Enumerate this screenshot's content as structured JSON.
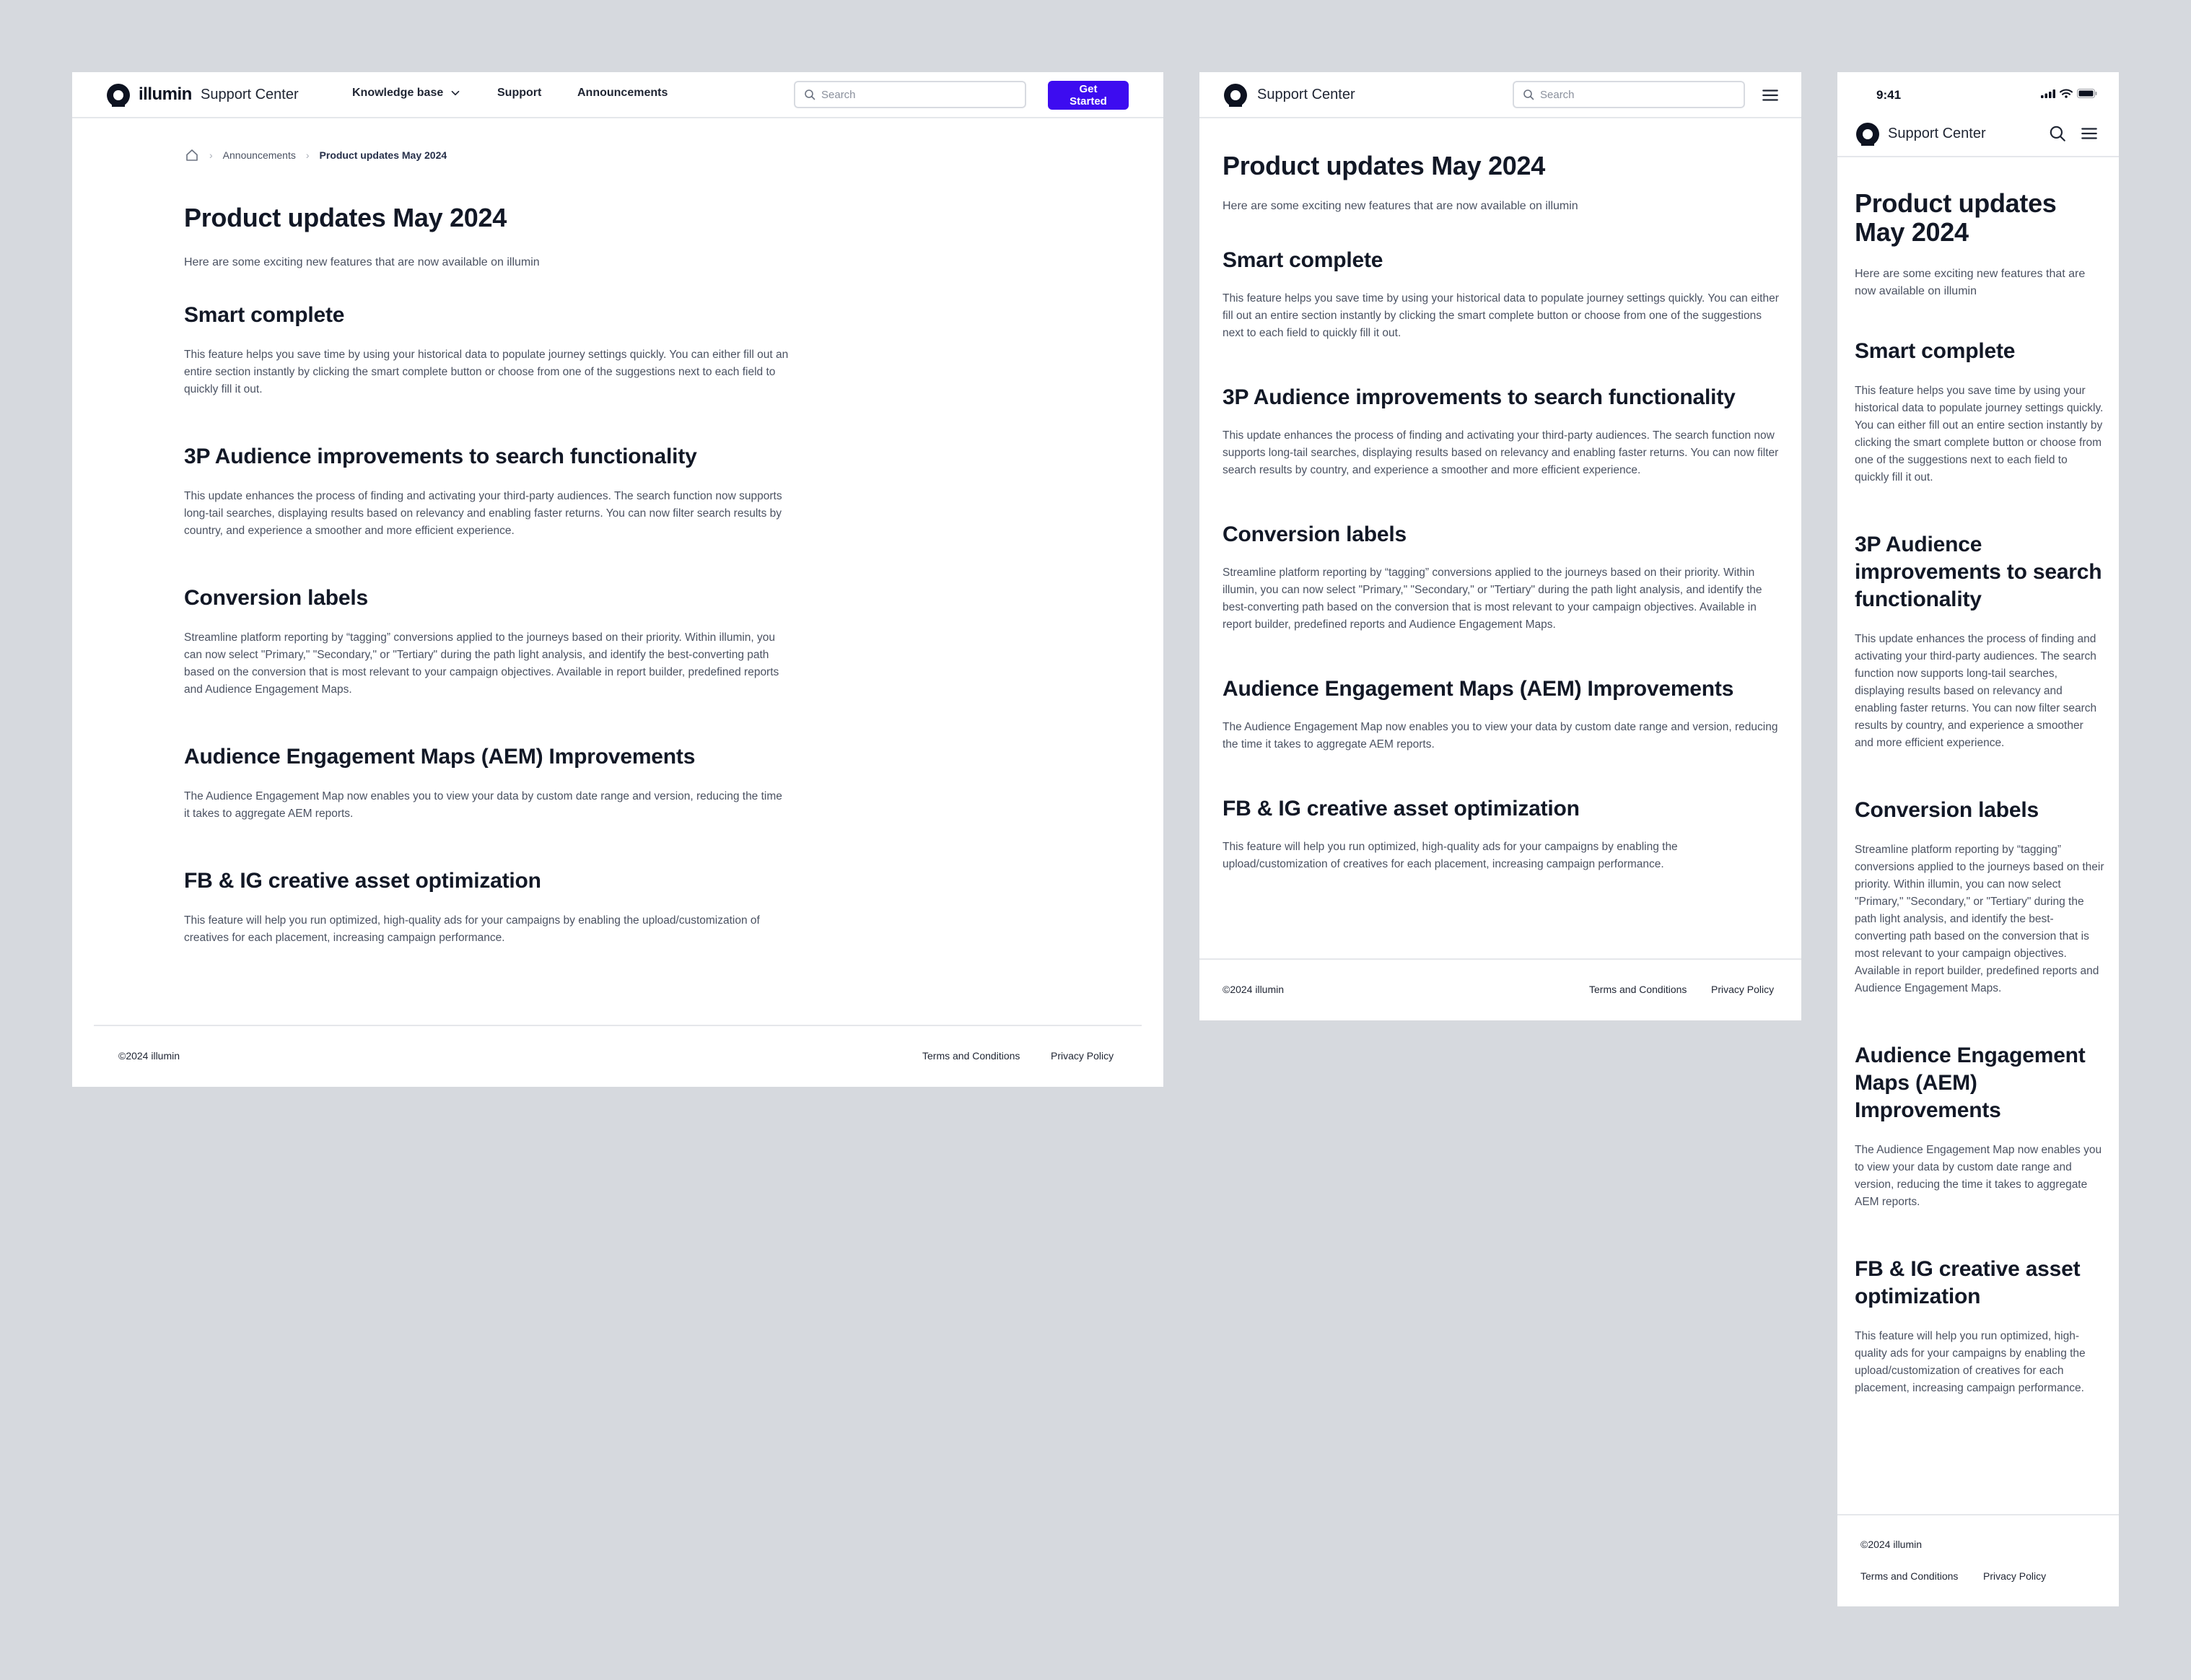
{
  "brand": {
    "wordmark": "illumin",
    "site_name": "Support Center"
  },
  "nav": {
    "knowledge_base": "Knowledge base",
    "support": "Support",
    "announcements": "Announcements",
    "cta": "Get Started"
  },
  "search": {
    "placeholder": "Search"
  },
  "breadcrumb": {
    "home_icon": "home-icon",
    "parent": "Announcements",
    "current": "Product updates May 2024"
  },
  "status_bar": {
    "time": "9:41"
  },
  "article": {
    "title": "Product updates May 2024",
    "intro": "Here are some exciting new features that are now available on illumin",
    "sections": [
      {
        "heading": "Smart complete",
        "body": "This feature helps you save time by using your historical data to populate journey settings quickly. You can either fill out an entire section instantly by clicking the smart complete button or choose from one of the suggestions next to each field to quickly fill it out."
      },
      {
        "heading": "3P Audience improvements to search functionality",
        "body": "This update enhances the process of finding and activating your third-party audiences. The search function now supports long-tail searches, displaying results based on relevancy and enabling faster returns. You can now filter search results by country, and experience a smoother and more efficient experience."
      },
      {
        "heading": "Conversion labels",
        "body": "Streamline platform reporting by “tagging” conversions applied to the journeys based on their priority. Within illumin, you can now select \"Primary,\" \"Secondary,\" or \"Tertiary\" during the path light analysis, and identify the best-converting path based on the conversion that is most relevant to your campaign objectives. Available in report builder, predefined reports and Audience Engagement Maps."
      },
      {
        "heading": "Audience Engagement Maps (AEM) Improvements",
        "body": "The Audience Engagement Map now enables you to view your data by custom date range and version, reducing the time it takes to aggregate AEM reports."
      },
      {
        "heading": "FB & IG creative asset optimization",
        "body": "This feature will help you run optimized, high-quality ads for your campaigns by enabling the upload/customization of creatives for each placement, increasing campaign performance."
      }
    ]
  },
  "footer": {
    "copyright": "©2024 illumin",
    "terms": "Terms and Conditions",
    "privacy": "Privacy Policy"
  },
  "colors": {
    "accent": "#3d0cf0",
    "background": "#d6d9de",
    "text_primary": "#121826",
    "text_secondary": "#4b5262"
  }
}
